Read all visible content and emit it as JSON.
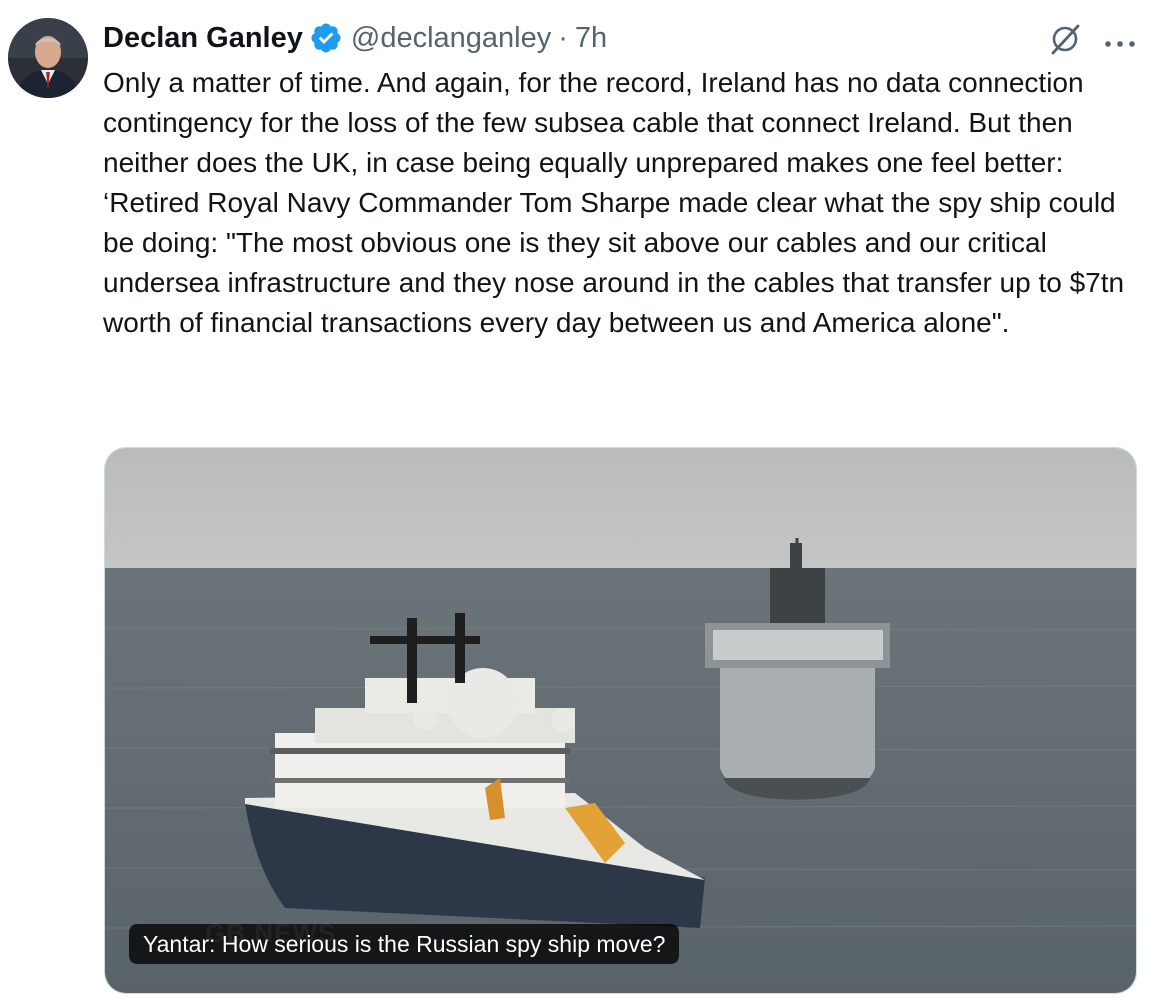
{
  "tweet": {
    "author_name": "Declan Ganley",
    "handle": "@declanganley",
    "separator": "·",
    "time": "7h",
    "verified": true,
    "accent_color": "#1d9bf0",
    "body_paragraphs": [
      "Only a matter of time. And again, for the record, Ireland has no data connection contingency for the loss of the few subsea cable that connect Ireland. But then neither does the UK, in case being equally unprepared makes one feel better:",
      "‘Retired Royal Navy Commander Tom Sharpe made clear what the spy ship could be doing: \"The most obvious one is they sit above our cables and our critical undersea infrastructure and they nose around in the cables that transfer up to $7tn worth of financial transactions every day between us and America alone\"."
    ],
    "media": {
      "caption": "Yantar: How serious is the Russian spy ship move?",
      "watermark": "GB NEWS"
    }
  },
  "icons": {
    "verified": "verified-badge-icon",
    "grok": "grok-icon",
    "more": "more-dots-icon"
  }
}
